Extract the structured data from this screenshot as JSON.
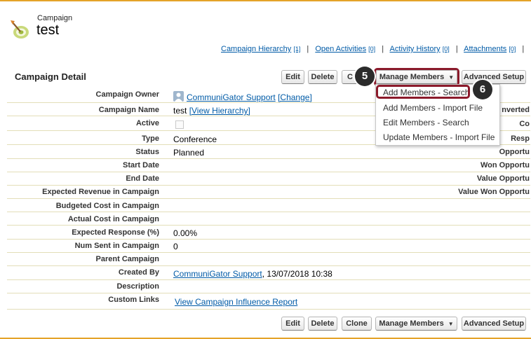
{
  "header": {
    "object_label": "Campaign",
    "record_name": "test"
  },
  "related_links": [
    {
      "label": "Campaign Hierarchy",
      "count": "[1]"
    },
    {
      "label": "Open Activities",
      "count": "[0]"
    },
    {
      "label": "Activity History",
      "count": "[0]"
    },
    {
      "label": "Attachments",
      "count": "[0]"
    }
  ],
  "separator": "|",
  "section": {
    "title": "Campaign Detail"
  },
  "buttons": {
    "edit": "Edit",
    "delete": "Delete",
    "clone": "Clone",
    "clone_truncated": "C",
    "manage_members": "Manage Members",
    "manage_members_arrow": "▼",
    "advanced_setup": "Advanced Setup"
  },
  "markers": {
    "step5": "5",
    "step6": "6"
  },
  "manage_members_menu": [
    "Add Members - Search",
    "Add Members - Import File",
    "Edit Members - Search",
    "Update Members - Import File"
  ],
  "fields": {
    "campaign_owner": {
      "label": "Campaign Owner",
      "value": "CommuniGator Support",
      "change": "[Change]"
    },
    "campaign_name": {
      "label": "Campaign Name",
      "value": "test",
      "link": "[View Hierarchy]"
    },
    "active": {
      "label": "Active",
      "checked": false
    },
    "type": {
      "label": "Type",
      "value": "Conference"
    },
    "status": {
      "label": "Status",
      "value": "Planned"
    },
    "start_date": {
      "label": "Start Date",
      "value": ""
    },
    "end_date": {
      "label": "End Date",
      "value": ""
    },
    "expected_revenue": {
      "label": "Expected Revenue in Campaign",
      "value": ""
    },
    "budgeted_cost": {
      "label": "Budgeted Cost in Campaign",
      "value": ""
    },
    "actual_cost": {
      "label": "Actual Cost in Campaign",
      "value": ""
    },
    "expected_response": {
      "label": "Expected Response (%)",
      "value": "0.00%"
    },
    "num_sent": {
      "label": "Num Sent in Campaign",
      "value": "0"
    },
    "parent_campaign": {
      "label": "Parent Campaign",
      "value": ""
    },
    "created_by": {
      "label": "Created By",
      "user": "CommuniGator Support",
      "date": ", 13/07/2018 10:38"
    },
    "description": {
      "label": "Description",
      "value": ""
    },
    "custom_links": {
      "label": "Custom Links",
      "link": "View Campaign Influence Report"
    }
  },
  "right_column_labels": [
    "nverted",
    "Co",
    "Resp",
    "Opportu",
    "Won Opportu",
    "Value Opportu",
    "Value Won Opportu"
  ],
  "colors": {
    "accent_rule": "#e4a329",
    "link": "#015ba7",
    "highlight": "#8b1a2b",
    "marker_bg": "#2b2b2b"
  }
}
